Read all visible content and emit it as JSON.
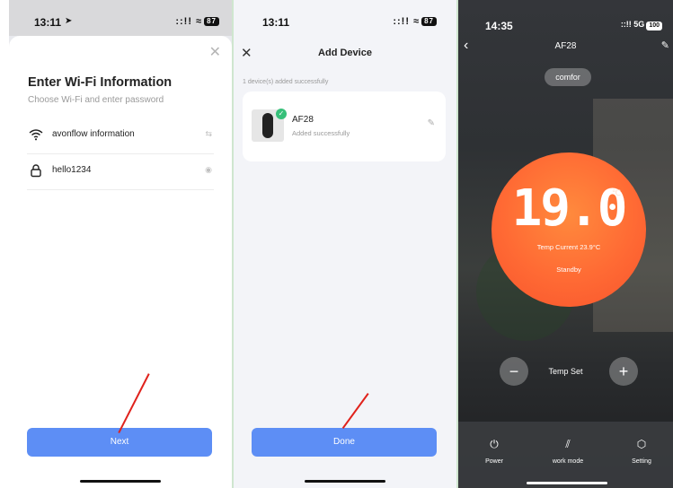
{
  "wifi_screen": {
    "status_time": "13:11",
    "status_icons": "::!! ≈",
    "battery": "87",
    "title": "Enter Wi-Fi Information",
    "subtitle": "Choose Wi-Fi and enter password",
    "ssid": "avonflow information",
    "password": "hello1234",
    "next_label": "Next"
  },
  "add_device_screen": {
    "status_time": "13:11",
    "status_icons": "::!! ≈",
    "battery": "87",
    "title": "Add Device",
    "added_count": "1 device(s) added successfully",
    "device_name": "AF28",
    "device_status": "Added successfully",
    "done_label": "Done"
  },
  "thermostat_screen": {
    "status_time": "14:35",
    "status_signal": "::!! 5G",
    "battery": "100",
    "device_name": "AF28",
    "mode_pill": "comfor",
    "temperature": "19.0",
    "unit": "℃",
    "current_temp": "Temp Current 23.9°C",
    "state": "Standby",
    "temp_set_label": "Temp Set",
    "minus": "−",
    "plus": "+",
    "bottom_items": [
      {
        "label": "Power",
        "icon": "power-icon"
      },
      {
        "label": "work mode",
        "icon": "work-mode-icon"
      },
      {
        "label": "Setting",
        "icon": "setting-icon"
      }
    ]
  },
  "colors": {
    "primary_button": "#5d8ef5",
    "dial": "#ff6a34",
    "success": "#37c07a",
    "annotation": "#e0221c"
  }
}
